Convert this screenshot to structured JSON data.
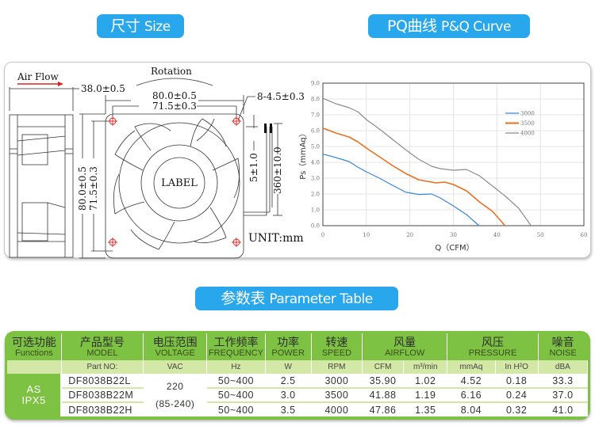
{
  "sections": {
    "size": {
      "zh": "尺寸",
      "en": "Size"
    },
    "pq": {
      "zh": "PQ曲线",
      "en": "P&Q Curve"
    },
    "param": {
      "zh": "参数表",
      "en": "Parameter Table"
    }
  },
  "drawing": {
    "air_flow_label": "Air Flow",
    "rotation_label": "Rotation",
    "depth": "38.0±0.5",
    "outer_width": "80.0±0.5",
    "hole_spacing": "71.5±0.3",
    "outer_height": "80.0±0.5",
    "hole_spacing_v": "71.5±0.3",
    "mount_holes": "8-4.5±0.3",
    "strip_length": "5±1.0",
    "lead_length": "360±10.0",
    "center_label": "LABEL",
    "unit": "UNIT:mm",
    "colors": {
      "airflow_arrow": "#e0201c",
      "hole_mark": "#e0201c"
    }
  },
  "chart_data": {
    "type": "line",
    "title": "",
    "xlabel": "Q（CFM）",
    "ylabel": "Ps（mmAq）",
    "xlim": [
      0,
      60
    ],
    "ylim": [
      0,
      9
    ],
    "x_ticks": [
      "0",
      "10",
      "20",
      "30",
      "40",
      "50",
      "60"
    ],
    "y_ticks": [
      "0.0",
      "1.0",
      "2.0",
      "3.0",
      "4.0",
      "5.0",
      "6.0",
      "7.0",
      "8.0",
      "9.0"
    ],
    "grid": true,
    "legend_position": "top-right",
    "series": [
      {
        "name": "3000",
        "color": "#3b86d4",
        "x": [
          0,
          3,
          6,
          8,
          10,
          13,
          16,
          19,
          22,
          25,
          27,
          30,
          33,
          35.9
        ],
        "y": [
          4.52,
          4.3,
          4.05,
          3.7,
          3.4,
          3.0,
          2.55,
          2.12,
          1.97,
          2.0,
          1.75,
          1.25,
          0.7,
          0
        ]
      },
      {
        "name": "3500",
        "color": "#e9711c",
        "x": [
          0,
          3,
          6,
          8,
          10,
          13,
          16,
          19,
          22,
          24,
          26,
          28,
          30,
          33,
          36,
          39,
          41.88
        ],
        "y": [
          6.16,
          5.85,
          5.6,
          5.3,
          4.9,
          4.35,
          3.8,
          3.3,
          2.9,
          2.8,
          2.7,
          2.75,
          2.6,
          2.2,
          1.5,
          0.9,
          0
        ]
      },
      {
        "name": "4000",
        "color": "#8c8c8c",
        "x": [
          0,
          3,
          6,
          8,
          10,
          13,
          16,
          19,
          22,
          25,
          27,
          30,
          33,
          36,
          39,
          42,
          45,
          47.86
        ],
        "y": [
          8.04,
          7.7,
          7.45,
          7.2,
          6.7,
          6.1,
          5.45,
          4.8,
          4.2,
          3.75,
          3.6,
          3.5,
          3.55,
          3.15,
          2.5,
          1.85,
          1.1,
          0
        ]
      }
    ]
  },
  "table": {
    "headers": [
      {
        "zh": "可选功能",
        "en": "Functions"
      },
      {
        "zh": "产品型号",
        "en": "MODEL"
      },
      {
        "zh": "电压范围",
        "en": "VOLTAGE"
      },
      {
        "zh": "工作频率",
        "en": "FREQUENCY"
      },
      {
        "zh": "功率",
        "en": "POWER"
      },
      {
        "zh": "转速",
        "en": "SPEED"
      },
      {
        "zh": "风量",
        "en": "AIRFLOW"
      },
      {
        "zh": "风压",
        "en": "PRESSURE"
      },
      {
        "zh": "噪音",
        "en": "NOISE"
      }
    ],
    "units": {
      "model": "Part NO:",
      "voltage": "VAC",
      "frequency": "Hz",
      "power": "W",
      "speed": "RPM",
      "airflow_cfm": "CFM",
      "airflow_m3": "m³/min",
      "pressure_mmaq": "mmAq",
      "pressure_inh2o": "In H²O",
      "noise": "dBA"
    },
    "function": {
      "line1": "AS",
      "line2": "IPX5"
    },
    "voltage": {
      "line1": "220",
      "line2": "(85-240)"
    },
    "rows": [
      {
        "model": "DF8038B22L",
        "frequency": "50~400",
        "power": "2.5",
        "speed": "3000",
        "cfm": "35.90",
        "m3": "1.02",
        "mmaq": "4.52",
        "inh2o": "0.18",
        "noise": "33.3"
      },
      {
        "model": "DF8038B22M",
        "frequency": "50~400",
        "power": "3.0",
        "speed": "3500",
        "cfm": "41.88",
        "m3": "1.19",
        "mmaq": "6.16",
        "inh2o": "0.24",
        "noise": "37.0"
      },
      {
        "model": "DF8038B22H",
        "frequency": "50~400",
        "power": "3.5",
        "speed": "4000",
        "cfm": "47.86",
        "m3": "1.35",
        "mmaq": "8.04",
        "inh2o": "0.32",
        "noise": "41.0"
      }
    ],
    "colors": {
      "header_green": "#7dc242",
      "unit_row": "#d3e8a6"
    }
  }
}
